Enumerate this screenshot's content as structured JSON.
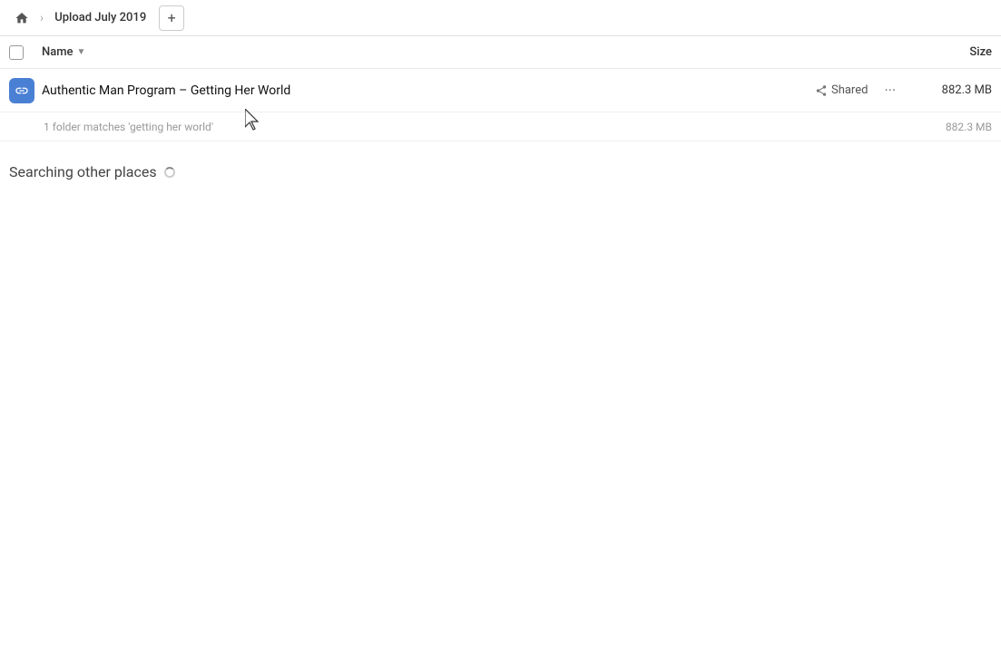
{
  "header": {
    "home_label": "Home",
    "breadcrumb_label": "Upload July 2019",
    "add_button_label": "+"
  },
  "columns": {
    "name_label": "Name",
    "size_label": "Size"
  },
  "file_row": {
    "file_name": "Authentic Man Program – Getting Her World",
    "shared_label": "Shared",
    "size": "882.3 MB"
  },
  "match_info": {
    "text": "1 folder matches 'getting her world'",
    "size": "882.3 MB"
  },
  "searching": {
    "label": "Searching other places"
  }
}
